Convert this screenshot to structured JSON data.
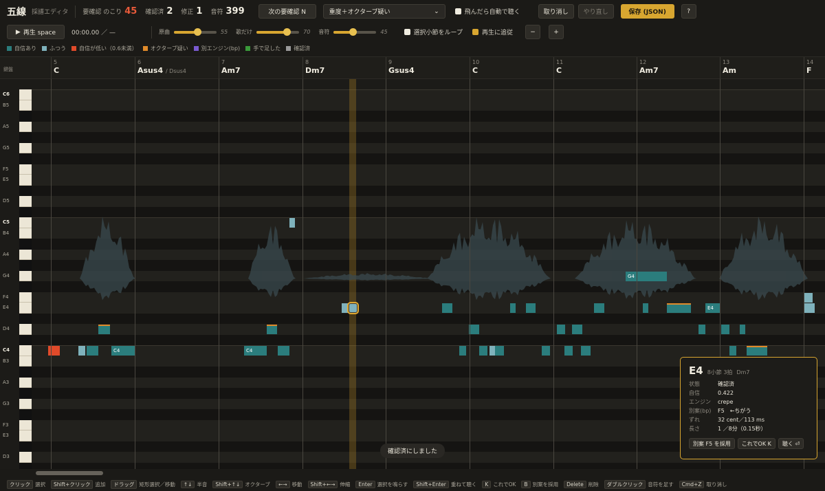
{
  "header": {
    "title": "五線",
    "subtitle": "採譜エディタ",
    "stats": [
      {
        "label": "要確認 のこり",
        "value": "45",
        "color": "#e85a3a"
      },
      {
        "label": "確認済",
        "value": "2"
      },
      {
        "label": "修正",
        "value": "1"
      },
      {
        "label": "音符",
        "value": "399"
      }
    ],
    "next_button": "次の要確認 N",
    "filter_select": "重度＋オクターブ疑い",
    "auto_listen": "飛んだら自動で聴く",
    "undo": "取り消し",
    "redo": "やり直し",
    "save": "保存 (JSON)",
    "help": "?"
  },
  "transport": {
    "play": "再生 space",
    "time": "00:00.00 ／ —",
    "sliders": [
      {
        "label": "原曲",
        "value": 55
      },
      {
        "label": "歌だけ",
        "value": 70
      },
      {
        "label": "音符",
        "value": 45
      }
    ],
    "loop": "選択小節をループ",
    "follow": "再生に追従",
    "zoom_out": "−",
    "zoom_in": "+"
  },
  "legend": [
    {
      "label": "自信あり",
      "color": "#2b7d7d"
    },
    {
      "label": "ふつう",
      "color": "#7fb2bc"
    },
    {
      "label": "自信が低い（0.6未満）",
      "color": "#e04a2a"
    },
    {
      "label": "オクターブ疑い",
      "color": "#e08a2a"
    },
    {
      "label": "別エンジン(bp)",
      "color": "#7a5ad0"
    },
    {
      "label": "手で足した",
      "color": "#3a9a3a"
    },
    {
      "label": "確認済",
      "color": "#9a9a9a"
    }
  ],
  "ruler": {
    "keys_header": "鍵盤",
    "measures": [
      {
        "num": "5",
        "chord": "C",
        "alt": ""
      },
      {
        "num": "6",
        "chord": "Asus4",
        "alt": "/ Dsus4"
      },
      {
        "num": "7",
        "chord": "Am7",
        "alt": ""
      },
      {
        "num": "8",
        "chord": "Dm7",
        "alt": ""
      },
      {
        "num": "9",
        "chord": "Gsus4",
        "alt": ""
      },
      {
        "num": "10",
        "chord": "C",
        "alt": ""
      },
      {
        "num": "11",
        "chord": "C",
        "alt": ""
      },
      {
        "num": "12",
        "chord": "Am7",
        "alt": ""
      },
      {
        "num": "13",
        "chord": "Am",
        "alt": ""
      },
      {
        "num": "14",
        "chord": "F",
        "alt": ""
      }
    ]
  },
  "pitch_labels": [
    "C6",
    "B5",
    "A5",
    "G5",
    "F5",
    "E5",
    "D5",
    "C5",
    "B4",
    "A4",
    "G4",
    "F4",
    "E4",
    "D4",
    "C4",
    "B3",
    "A3",
    "G3",
    "F3",
    "E3",
    "D3"
  ],
  "note_labels": {
    "c4a": "C4",
    "c4b": "C4",
    "g4": "G4",
    "e4": "E4"
  },
  "popup": {
    "note": "E4",
    "position": "8小節 3拍",
    "chord": "Dm7",
    "rows": [
      {
        "k": "状態",
        "v": "確認済"
      },
      {
        "k": "自信",
        "v": "0.422"
      },
      {
        "k": "エンジン",
        "v": "crepe"
      },
      {
        "k": "別案(bp)",
        "v": "F5　←ちがう"
      },
      {
        "k": "ずれ",
        "v": "32 cent／113 ms"
      },
      {
        "k": "長さ",
        "v": "1 ／8分（0.15秒）"
      }
    ],
    "buttons": [
      "別案 F5 を採用",
      "これでOK K",
      "聴く ⏎"
    ]
  },
  "toast": "確認済にしました",
  "hints": [
    {
      "k": "クリック",
      "d": "選択"
    },
    {
      "k": "Shift+クリック",
      "d": "追加"
    },
    {
      "k": "ドラッグ",
      "d": "矩形選択／移動"
    },
    {
      "k": "↑↓",
      "d": "半音"
    },
    {
      "k": "Shift+↑↓",
      "d": "オクターブ"
    },
    {
      "k": "←→",
      "d": "移動"
    },
    {
      "k": "Shift+←→",
      "d": "伸縮"
    },
    {
      "k": "Enter",
      "d": "選択を鳴らす"
    },
    {
      "k": "Shift+Enter",
      "d": "重ねて聴く"
    },
    {
      "k": "K",
      "d": "これでOK"
    },
    {
      "k": "B",
      "d": "別案を採用"
    },
    {
      "k": "Delete",
      "d": "削除"
    },
    {
      "k": "ダブルクリック",
      "d": "音符を足す"
    },
    {
      "k": "Cmd+Z",
      "d": "取り消し"
    }
  ]
}
